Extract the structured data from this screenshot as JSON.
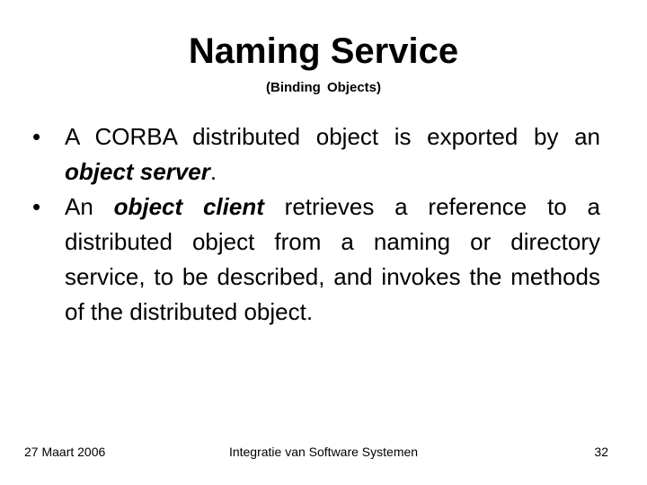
{
  "slide": {
    "title": "Naming Service",
    "subtitle": "(Binding  Objects)",
    "bullets": [
      {
        "icon": "bullet-dot",
        "glyph": "•",
        "parts": [
          {
            "text": "A CORBA distributed object is exported by an ",
            "emphasis": false
          },
          {
            "text": "object server",
            "emphasis": true
          },
          {
            "text": ".",
            "emphasis": false
          }
        ]
      },
      {
        "icon": "bullet-dot",
        "glyph": "•",
        "parts": [
          {
            "text": "An ",
            "emphasis": false
          },
          {
            "text": "object client",
            "emphasis": true
          },
          {
            "text": " retrieves a reference to a distributed object from a naming or directory service, to be described, and invokes the methods of the distributed object.",
            "emphasis": false
          }
        ]
      }
    ]
  },
  "footer": {
    "date": "27 Maart 2006",
    "course": "Integratie van Software Systemen",
    "page_number": "32"
  }
}
